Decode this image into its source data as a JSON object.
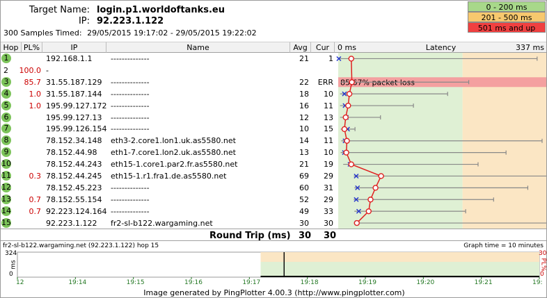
{
  "header": {
    "target_label": "Target Name:",
    "target_value": "login.p1.worldoftanks.eu",
    "ip_label": "IP:",
    "ip_value": "92.223.1.122",
    "samples_label": "300 Samples Timed:",
    "samples_value": "29/05/2015 19:17:02 - 29/05/2015 19:22:02"
  },
  "legend": [
    {
      "label": "0 - 200 ms",
      "color": "#a8d88a"
    },
    {
      "label": "201 - 500 ms",
      "color": "#f7c86e"
    },
    {
      "label": "501 ms and up",
      "color": "#f04040"
    }
  ],
  "columns": {
    "hop": "Hop",
    "pl": "PL%",
    "ip": "IP",
    "name": "Name",
    "avg": "Avg",
    "cur": "Cur",
    "latency": "Latency",
    "lat_min": "0 ms",
    "lat_max": "337 ms"
  },
  "hops": [
    {
      "hop": "1",
      "pl": "",
      "ip": "192.168.1.1",
      "name": "--------------",
      "avg": "21",
      "cur": "1",
      "min": 1,
      "max": 320,
      "green": true
    },
    {
      "hop": "2",
      "pl": "100.0",
      "ip": "-",
      "name": "",
      "avg": "",
      "cur": "",
      "min": null,
      "max": null,
      "green": false
    },
    {
      "hop": "3",
      "pl": "85.7",
      "ip": "31.55.187.129",
      "name": "--------------",
      "avg": "22",
      "cur": "ERR",
      "min": 4,
      "max": 210,
      "green": true,
      "loss_text": "85.67% packet loss"
    },
    {
      "hop": "4",
      "pl": "1.0",
      "ip": "31.55.187.144",
      "name": "--------------",
      "avg": "18",
      "cur": "10",
      "min": 3,
      "max": 176,
      "green": true
    },
    {
      "hop": "5",
      "pl": "1.0",
      "ip": "195.99.127.172",
      "name": "--------------",
      "avg": "16",
      "cur": "11",
      "min": 3,
      "max": 121,
      "green": true
    },
    {
      "hop": "6",
      "pl": "",
      "ip": "195.99.127.13",
      "name": "--------------",
      "avg": "12",
      "cur": "13",
      "min": 3,
      "max": 68,
      "green": true
    },
    {
      "hop": "7",
      "pl": "",
      "ip": "195.99.126.154",
      "name": "--------------",
      "avg": "10",
      "cur": "15",
      "min": 4,
      "max": 27,
      "green": true
    },
    {
      "hop": "8",
      "pl": "",
      "ip": "78.152.34.148",
      "name": "eth3-2.core1.lon1.uk.as5580.net",
      "avg": "14",
      "cur": "11",
      "min": 5,
      "max": 328,
      "green": true
    },
    {
      "hop": "9",
      "pl": "",
      "ip": "78.152.44.98",
      "name": "eth1-7.core1.lon2.uk.as5580.net",
      "avg": "13",
      "cur": "10",
      "min": 4,
      "max": 270,
      "green": true
    },
    {
      "hop": "10",
      "pl": "",
      "ip": "78.152.44.243",
      "name": "eth15-1.core1.par2.fr.as5580.net",
      "avg": "21",
      "cur": "19",
      "min": 8,
      "max": 225,
      "green": true
    },
    {
      "hop": "11",
      "pl": "0.3",
      "ip": "78.152.44.245",
      "name": "eth15-1.r1.fra1.de.as5580.net",
      "avg": "69",
      "cur": "29",
      "min": 25,
      "max": 337,
      "green": true
    },
    {
      "hop": "12",
      "pl": "",
      "ip": "78.152.45.223",
      "name": "--------------",
      "avg": "60",
      "cur": "31",
      "min": 26,
      "max": 305,
      "green": true
    },
    {
      "hop": "13",
      "pl": "0.7",
      "ip": "78.152.55.154",
      "name": "--------------",
      "avg": "52",
      "cur": "29",
      "min": 25,
      "max": 250,
      "green": true
    },
    {
      "hop": "14",
      "pl": "0.7",
      "ip": "92.223.124.164",
      "name": "--------------",
      "avg": "49",
      "cur": "33",
      "min": 26,
      "max": 205,
      "green": true
    },
    {
      "hop": "15",
      "pl": "",
      "ip": "92.223.1.122",
      "name": "fr2-sl-b122.wargaming.net",
      "avg": "30",
      "cur": "30",
      "min": 25,
      "max": 337,
      "green": true
    }
  ],
  "round_trip": {
    "label": "Round Trip (ms)",
    "avg": "30",
    "cur": "30"
  },
  "mini_graph": {
    "title": "fr2-sl-b122.wargaming.net (92.223.1.122) hop 15",
    "graph_time": "Graph time = 10 minutes",
    "y_max": "324",
    "y_min": "0",
    "y_unit": "ms",
    "pl_max": "30",
    "pl_min": "0",
    "pl_unit": "PL%",
    "ticks": [
      "12",
      "19:14",
      "19:15",
      "19:16",
      "19:17",
      "19:18",
      "19:19",
      "19:20",
      "19:21",
      "19:"
    ]
  },
  "footer": "Image generated by PingPlotter 4.00.3 (http://www.pingplotter.com)"
}
